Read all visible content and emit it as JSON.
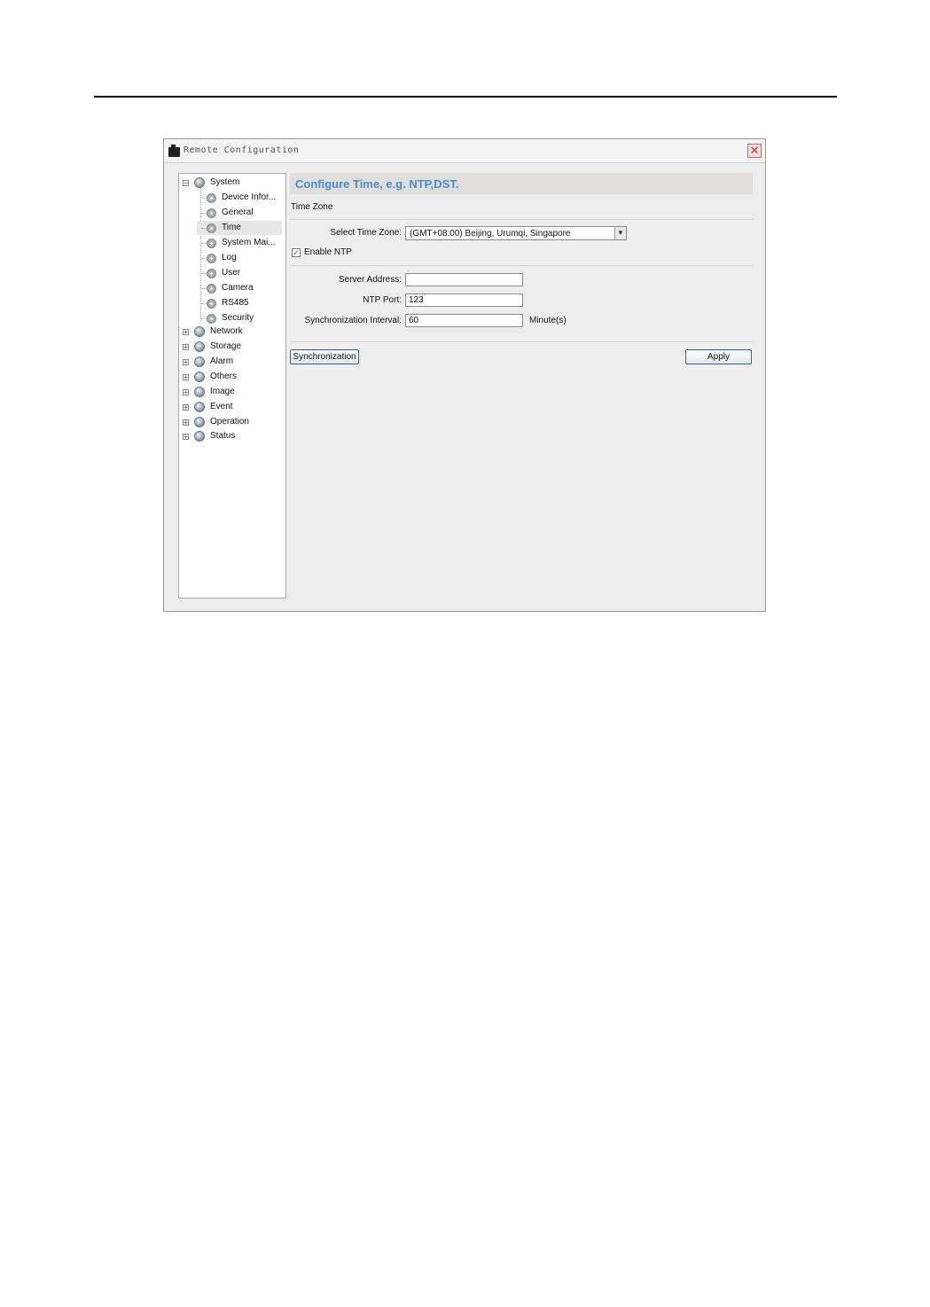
{
  "window": {
    "title": "Remote Configuration",
    "close_glyph": "✕"
  },
  "tree": {
    "root": {
      "label": "System",
      "children": [
        {
          "label": "Device Infor..."
        },
        {
          "label": "General"
        },
        {
          "label": "Time",
          "selected": true
        },
        {
          "label": "System Mai..."
        },
        {
          "label": "Log"
        },
        {
          "label": "User"
        },
        {
          "label": "Camera"
        },
        {
          "label": "RS485"
        },
        {
          "label": "Security"
        }
      ]
    },
    "groups": [
      {
        "label": "Network"
      },
      {
        "label": "Storage"
      },
      {
        "label": "Alarm"
      },
      {
        "label": "Others"
      },
      {
        "label": "Image"
      },
      {
        "label": "Event"
      },
      {
        "label": "Operation"
      },
      {
        "label": "Status"
      }
    ]
  },
  "main": {
    "banner": "Configure Time, e.g. NTP,DST.",
    "section_time_zone": "Time Zone",
    "time_zone_label": "Select Time Zone:",
    "time_zone_value": "(GMT+08:00) Beijing, Urumqi, Singapore",
    "enable_ntp_label": "Enable NTP",
    "enable_ntp_checked": true,
    "server_address_label": "Server Address:",
    "server_address_value": "",
    "ntp_port_label": "NTP Port:",
    "ntp_port_value": "123",
    "sync_interval_label": "Synchronization Interval:",
    "sync_interval_value": "60",
    "sync_interval_unit": "Minute(s)",
    "synchronization_button": "Synchronization",
    "apply_button": "Apply"
  },
  "icons": {
    "title": "camera-icon",
    "tree_group": "globe-icon",
    "tree_leaf": "gear-icon",
    "dropdown": "chevron-down-icon",
    "checkbox": "check-icon"
  }
}
